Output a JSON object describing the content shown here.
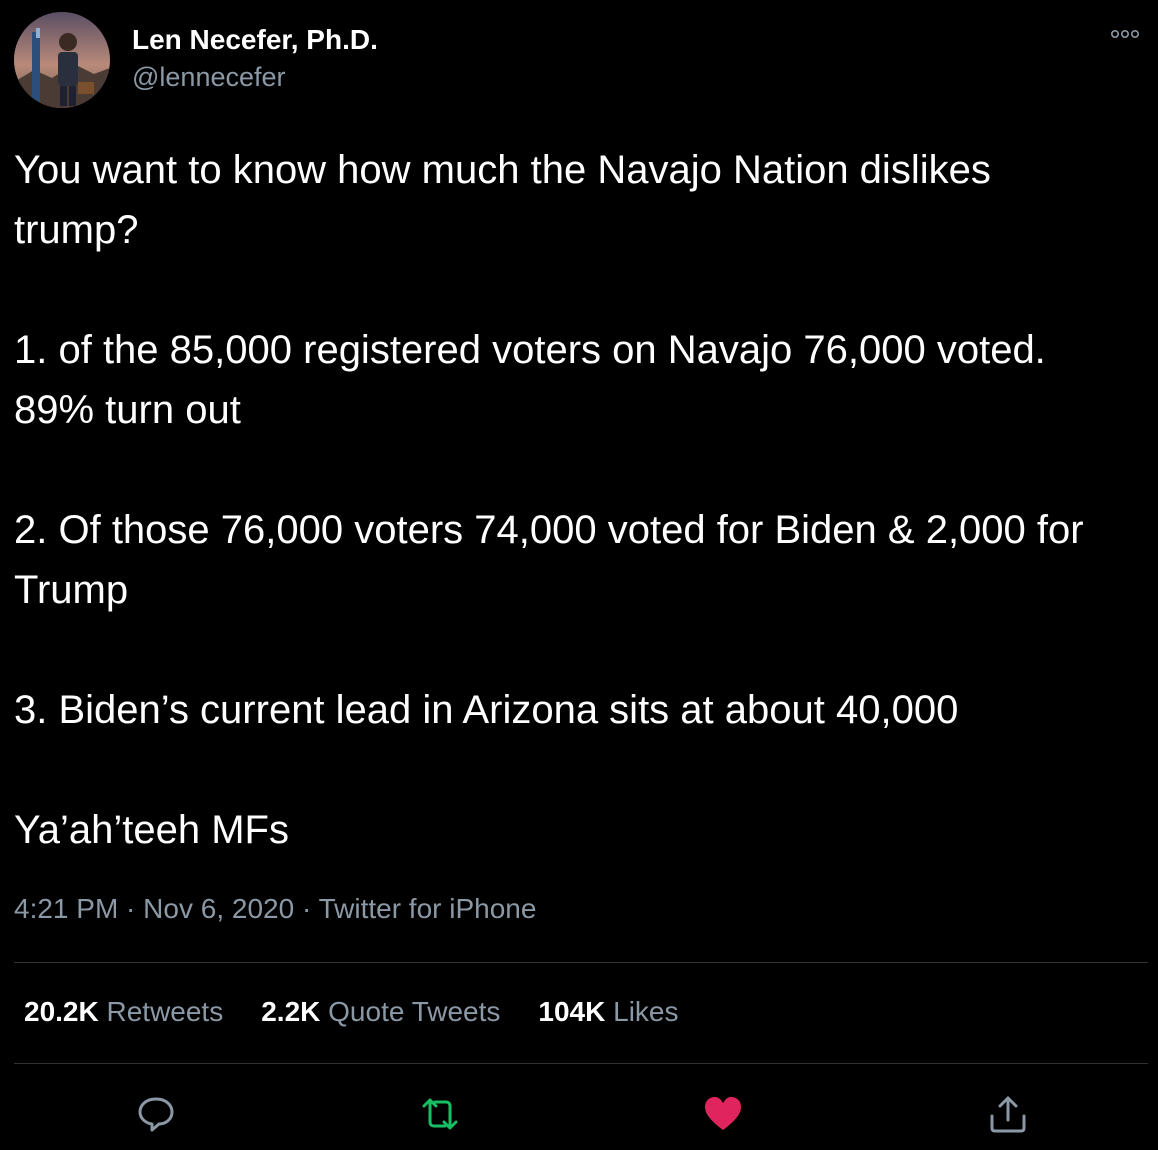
{
  "tweet": {
    "author": {
      "name": "Len Necefer, Ph.D.",
      "handle": "@lennecefer"
    },
    "paragraphs": [
      "You want to know how much the Navajo Nation dislikes trump?",
      "1. of the 85,000 registered voters on Navajo 76,000 voted. 89% turn out",
      "2. Of those 76,000 voters 74,000 voted for Biden & 2,000 for Trump",
      "3. Biden’s current lead in Arizona sits at about 40,000",
      "Ya’ah’teeh MFs"
    ],
    "meta": {
      "time": "4:21 PM",
      "separator": " · ",
      "date": "Nov 6, 2020",
      "source": "Twitter for iPhone"
    },
    "stats": {
      "retweets_count": "20.2K",
      "retweets_label": " Retweets",
      "quotes_count": "2.2K",
      "quotes_label": " Quote Tweets",
      "likes_count": "104K",
      "likes_label": " Likes"
    },
    "icons": {
      "more": "more-icon",
      "reply": "reply-icon",
      "retweet": "retweet-icon",
      "like": "heart-icon",
      "share": "share-icon"
    },
    "colors": {
      "background": "#000000",
      "text": "#ffffff",
      "secondary": "#8b98a5",
      "divider": "#2f3336",
      "retweet_active": "#17bf63",
      "like_active": "#e0245e"
    }
  }
}
